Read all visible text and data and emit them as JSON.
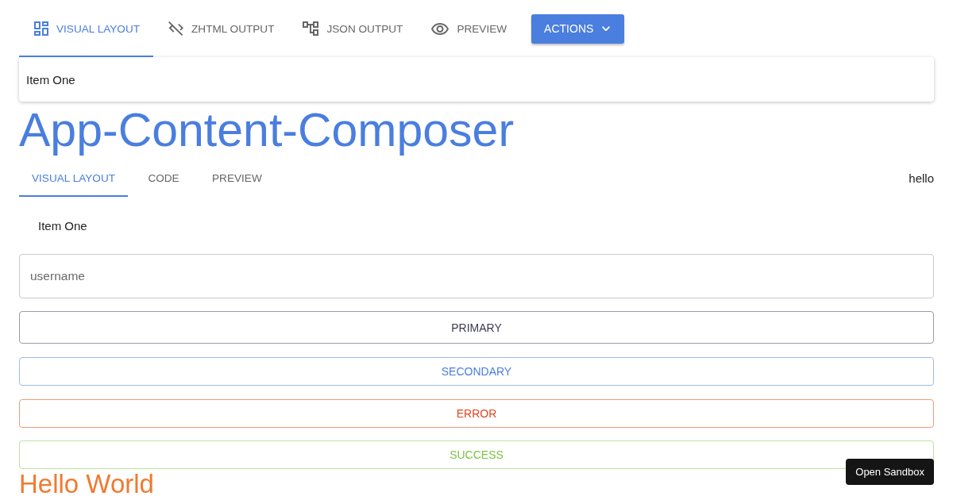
{
  "top_tabs": [
    {
      "label": "VISUAL LAYOUT",
      "selected": true
    },
    {
      "label": "ZHTML OUTPUT",
      "selected": false
    },
    {
      "label": "JSON OUTPUT",
      "selected": false
    },
    {
      "label": "PREVIEW",
      "selected": false
    }
  ],
  "actions_button": {
    "label": "ACTIONS"
  },
  "card": {
    "text": "Item One"
  },
  "title": "App-Content-Composer",
  "sub_tabs": [
    {
      "label": "VISUAL LAYOUT",
      "selected": true
    },
    {
      "label": "CODE",
      "selected": false
    },
    {
      "label": "PREVIEW",
      "selected": false
    }
  ],
  "side_text": "hello",
  "list_item": "Item One",
  "username_field": {
    "placeholder": "username"
  },
  "buttons": [
    {
      "label": "PRIMARY",
      "kind": "primary"
    },
    {
      "label": "SECONDARY",
      "kind": "secondary"
    },
    {
      "label": "ERROR",
      "kind": "error"
    },
    {
      "label": "SUCCESS",
      "kind": "success"
    }
  ],
  "footer_heading": "Hello World",
  "sandbox_button": {
    "label": "Open Sandbox"
  }
}
